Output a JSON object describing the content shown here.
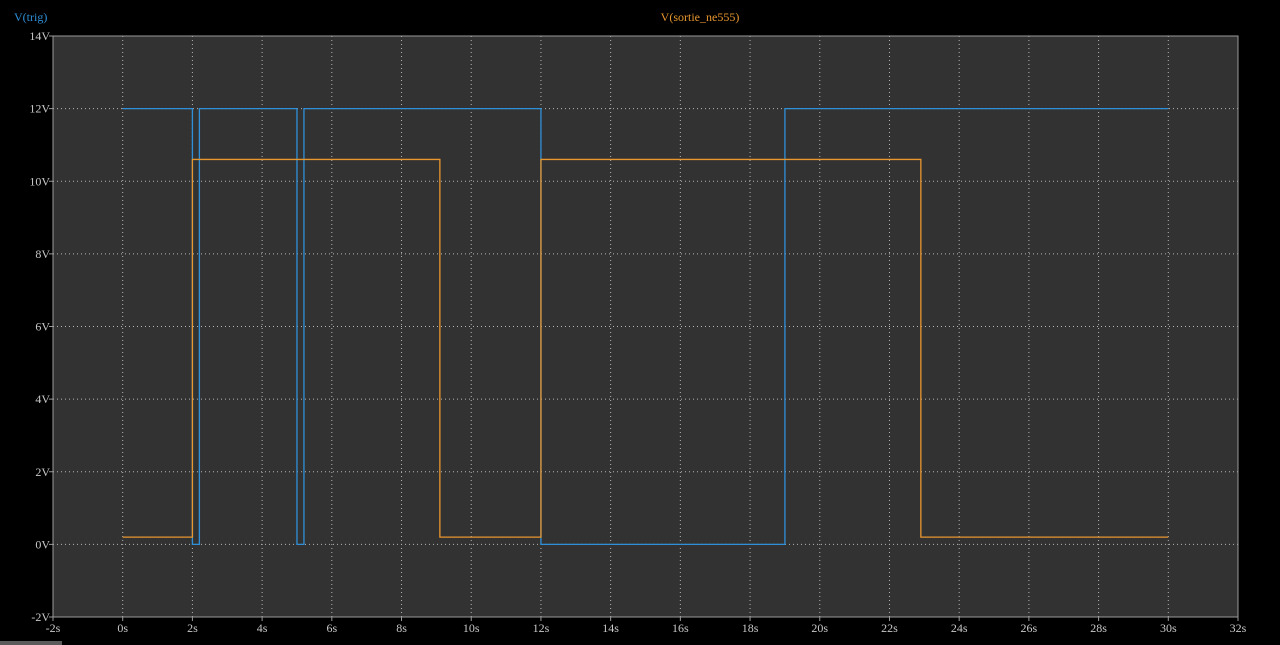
{
  "chart_data": {
    "type": "line",
    "title": "",
    "xlabel": "",
    "ylabel": "",
    "xlim": [
      -2,
      32
    ],
    "ylim": [
      -2,
      14
    ],
    "grid": true,
    "legend": "top",
    "x_ticks": [
      -2,
      0,
      2,
      4,
      6,
      8,
      10,
      12,
      14,
      16,
      18,
      20,
      22,
      24,
      26,
      28,
      30,
      32
    ],
    "x_tick_labels": [
      "-2s",
      "0s",
      "2s",
      "4s",
      "6s",
      "8s",
      "10s",
      "12s",
      "14s",
      "16s",
      "18s",
      "20s",
      "22s",
      "24s",
      "26s",
      "28s",
      "30s",
      "32s"
    ],
    "y_ticks": [
      -2,
      0,
      2,
      4,
      6,
      8,
      10,
      12,
      14
    ],
    "y_tick_labels": [
      "-2V",
      "0V",
      "2V",
      "4V",
      "6V",
      "8V",
      "10V",
      "12V",
      "14V"
    ],
    "series": [
      {
        "name": "V(trig)",
        "color": "#2f8fd8",
        "points": [
          [
            0,
            12
          ],
          [
            2,
            12
          ],
          [
            2,
            0
          ],
          [
            2.2,
            0
          ],
          [
            2.2,
            12
          ],
          [
            5,
            12
          ],
          [
            5,
            0
          ],
          [
            5.2,
            0
          ],
          [
            5.2,
            12
          ],
          [
            12,
            12
          ],
          [
            12,
            0
          ],
          [
            19,
            0
          ],
          [
            19,
            12
          ],
          [
            30,
            12
          ]
        ]
      },
      {
        "name": "V(sortie_ne555)",
        "color": "#e8962e",
        "points": [
          [
            0,
            0.2
          ],
          [
            2,
            0.2
          ],
          [
            2,
            10.6
          ],
          [
            9.1,
            10.6
          ],
          [
            9.1,
            0.2
          ],
          [
            12,
            0.2
          ],
          [
            12,
            10.6
          ],
          [
            22.9,
            10.6
          ],
          [
            22.9,
            0.2
          ],
          [
            30,
            0.2
          ]
        ]
      }
    ]
  },
  "colors": {
    "background": "#000000",
    "plot_background": "#323232",
    "grid": "#b4b4b4",
    "axis": "#9a9a9a",
    "tick_text": "#c8c8c8"
  }
}
